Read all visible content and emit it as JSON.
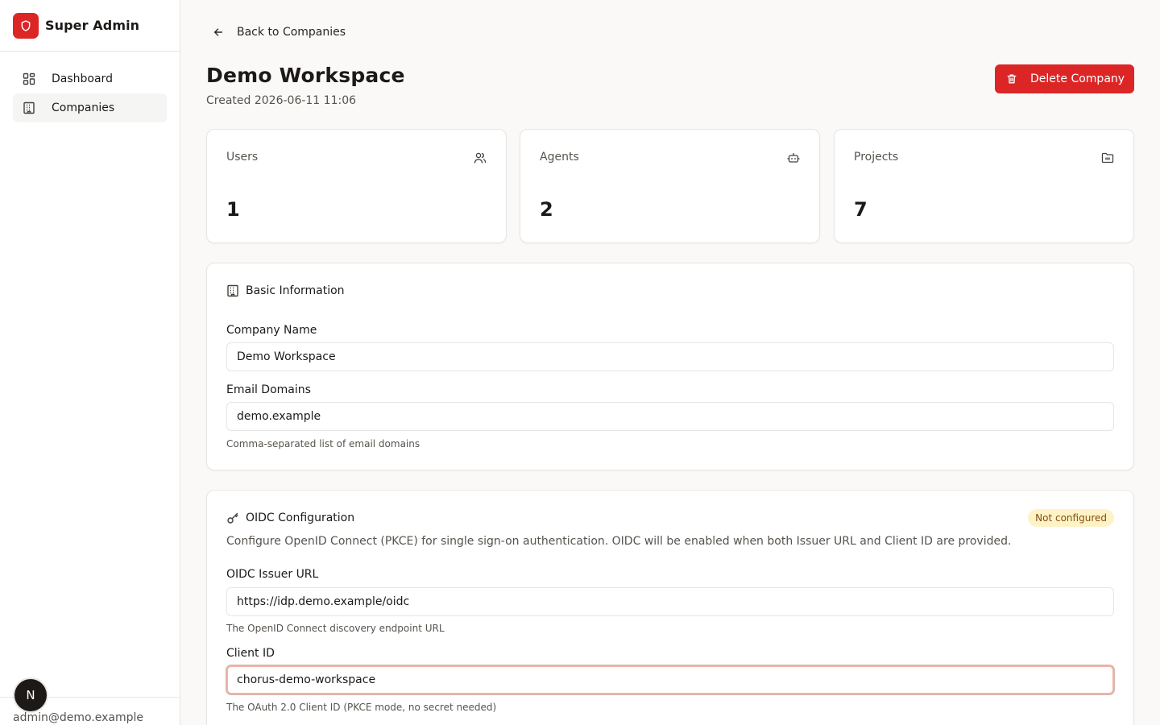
{
  "app": {
    "title": "Super Admin"
  },
  "sidebar": {
    "items": [
      {
        "label": "Dashboard",
        "icon": "dashboard-grid-icon",
        "active": false
      },
      {
        "label": "Companies",
        "icon": "building-icon",
        "active": true
      }
    ],
    "user": {
      "avatar_initial": "N",
      "email": "admin@demo.example"
    }
  },
  "header": {
    "back_label": "Back to Companies",
    "title": "Demo Workspace",
    "created": "Created 2026-06-11 11:06",
    "delete_label": "Delete Company"
  },
  "stats": [
    {
      "label": "Users",
      "value": "1",
      "icon": "users-icon"
    },
    {
      "label": "Agents",
      "value": "2",
      "icon": "bot-icon"
    },
    {
      "label": "Projects",
      "value": "7",
      "icon": "folder-icon"
    }
  ],
  "basic_info": {
    "title": "Basic Information",
    "company_name_label": "Company Name",
    "company_name_value": "Demo Workspace",
    "email_domains_label": "Email Domains",
    "email_domains_value": "demo.example",
    "email_domains_hint": "Comma-separated list of email domains"
  },
  "oidc": {
    "title": "OIDC Configuration",
    "status": "Not configured",
    "description": "Configure OpenID Connect (PKCE) for single sign-on authentication. OIDC will be enabled when both Issuer URL and Client ID are provided.",
    "issuer_label": "OIDC Issuer URL",
    "issuer_value": "https://idp.demo.example/oidc",
    "issuer_hint": "The OpenID Connect discovery endpoint URL",
    "client_id_label": "Client ID",
    "client_id_value": "chorus-demo-workspace",
    "client_id_hint": "The OAuth 2.0 Client ID (PKCE mode, no secret needed)"
  },
  "colors": {
    "accent": "#dc2626",
    "badge_bg": "#fef3c7",
    "badge_text": "#854d0e"
  }
}
